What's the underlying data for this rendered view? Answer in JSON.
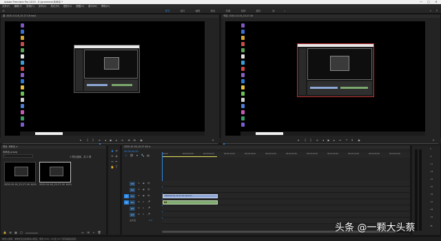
{
  "window": {
    "title": "Adobe Premiere Pro 2019 - E:\\premiere\\未命名 *",
    "controls": [
      "—",
      "□",
      "✕"
    ]
  },
  "menu": [
    "文件(F)",
    "编辑(E)",
    "剪辑(C)",
    "序列(S)",
    "标记(M)",
    "图形(G)",
    "视图(V)",
    "窗口(W)",
    "帮助(H)"
  ],
  "workspaces": {
    "tabs": [
      "学习",
      "组件",
      "编辑",
      "颜色",
      "效果",
      "音频",
      "图形",
      "库"
    ],
    "active_index": 0,
    "more": "»"
  },
  "source": {
    "title": "源: 2020-10-16_15-27-16.mp4",
    "timecode_left": "00;00;27;00",
    "fit_label": "适合",
    "timecode_right": "00;00;00;01"
  },
  "program": {
    "title": "节目: 2020-10-16_15-27-16",
    "timecode_left": "00;00;00;00",
    "fit_label": "适合",
    "quality": "完整",
    "timecode_right": "00;00;00;01"
  },
  "project": {
    "title": "项目: 未命名 ≡",
    "filename": "未命名.prproj",
    "items_label": "1 项已选择，共 2 项",
    "search_placeholder": "",
    "bins": [
      {
        "name": "2020-10-16_15-27-16.mp4",
        "duration": "6;00"
      },
      {
        "name": "2020-10-16_15-27-16",
        "duration": "6;00"
      }
    ]
  },
  "timeline": {
    "title": "2020-10-16_15-27-16 ≡",
    "timecode": "00;00;00;00",
    "ruler_labels": [
      ":00;00",
      "00;00;04;29",
      "00;00;09;29",
      "00;00;14;29",
      "00;00;19;29",
      "00;00;24;29",
      "00;00;29;29",
      "00;00;34;28",
      "00;00;39;28",
      "00;00;44;28",
      "00;00;49;28",
      "00;00;54;28"
    ],
    "tracks": [
      {
        "id": "V3",
        "toggles": [
          "⟲",
          "▣",
          "👁"
        ]
      },
      {
        "id": "V2",
        "toggles": [
          "⟲",
          "▣",
          "👁"
        ]
      },
      {
        "id": "V1",
        "toggles": [
          "⟲",
          "▣",
          "👁"
        ]
      },
      {
        "id": "A1",
        "toggles": [
          "M",
          "S",
          "🎤"
        ]
      },
      {
        "id": "A2",
        "toggles": [
          "M",
          "S",
          "🎤"
        ]
      },
      {
        "id": "A3",
        "toggles": [
          "M",
          "S",
          "🎤"
        ]
      }
    ],
    "master_label": "主声道",
    "master_value": "0.0",
    "video_clip_label": "2020-10-16_15-27-16.mp4 [V]",
    "audio_clip_label": "fx"
  },
  "meters": {
    "scale": [
      "0",
      "-6",
      "-12",
      "-18",
      "-24",
      "-30",
      "-36",
      "-42",
      "-48",
      "-54",
      "dB"
    ]
  },
  "status_bar": "单击以选择，或单击空白处拖动以框选。使用 Shift、Alt 和 Ctrl 可获得其他选项。",
  "watermark": "头条 @一颗大头蔡",
  "colors": {
    "accent": "#2d8ceb",
    "video_clip": "#8fa8d8",
    "audio_clip": "#7da96e",
    "play_range": "#e6e35a"
  }
}
